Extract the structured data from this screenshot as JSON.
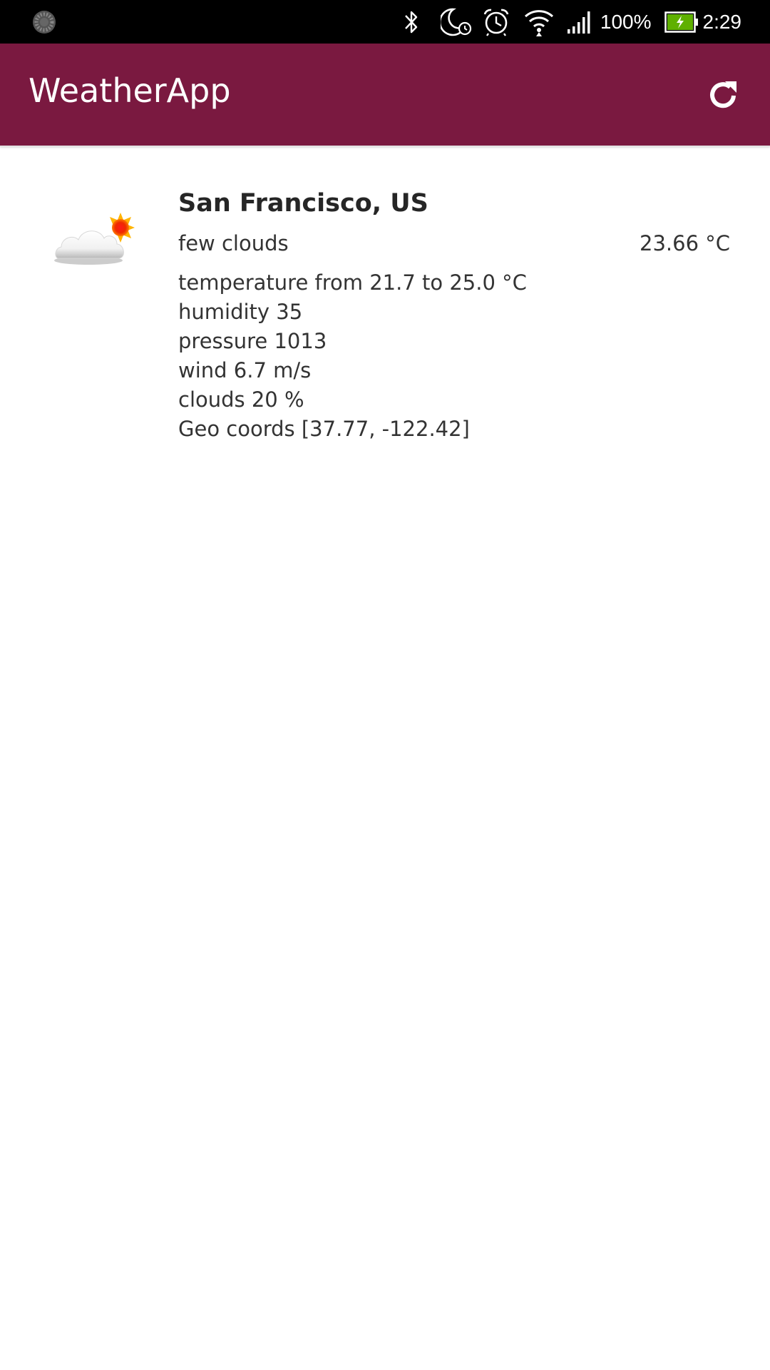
{
  "status_bar": {
    "battery_percent": "100%",
    "time": "2:29",
    "icons": [
      "loading-icon",
      "bluetooth-icon",
      "do-not-disturb-icon",
      "alarm-icon",
      "wifi-icon",
      "signal-icon",
      "battery-charging-icon"
    ]
  },
  "app_bar": {
    "title": "WeatherApp",
    "refresh_icon": "refresh-icon",
    "color": "#7a1940"
  },
  "weather": {
    "icon": "few-clouds-icon",
    "city": "San Francisco, US",
    "description": "few clouds",
    "current_temperature": "23.66 °C",
    "details": [
      "temperature from 21.7 to 25.0 °C",
      "humidity 35",
      "pressure 1013",
      "wind 6.7 m/s",
      "clouds 20 %",
      "Geo coords [37.77, -122.42]"
    ]
  }
}
